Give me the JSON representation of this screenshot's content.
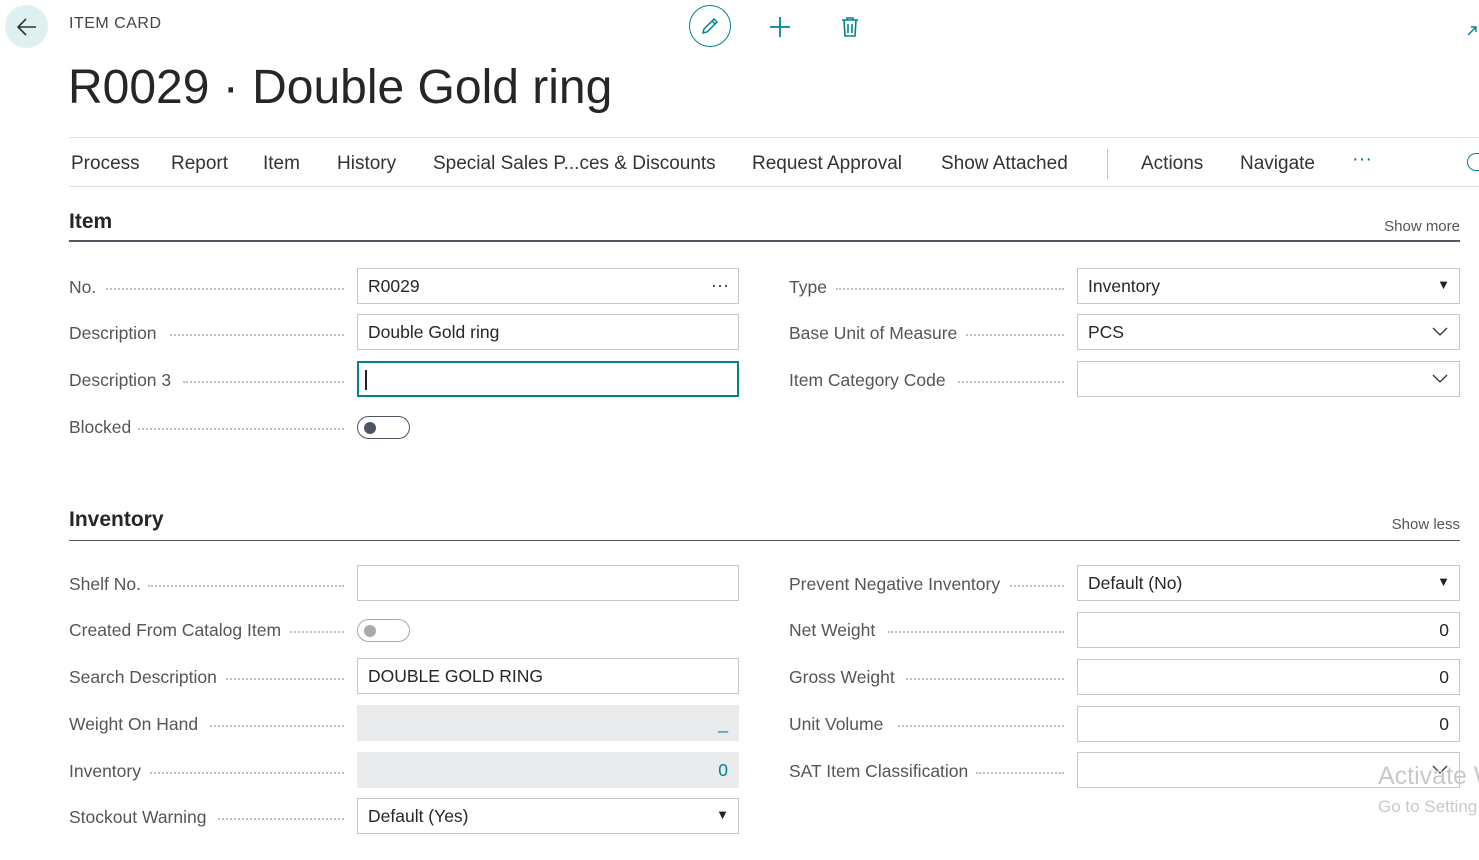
{
  "header": {
    "card_type": "ITEM CARD",
    "title": "R0029 · Double Gold ring"
  },
  "action_bar": {
    "items": [
      "Process",
      "Report",
      "Item",
      "History",
      "Special Sales P...ces & Discounts",
      "Request Approval",
      "Show Attached",
      "Actions",
      "Navigate"
    ],
    "more": "···"
  },
  "sections": {
    "item": {
      "title": "Item",
      "toggle": "Show more",
      "no_label": "No.",
      "no_value": "R0029",
      "description_label": "Description",
      "description_value": "Double Gold ring",
      "description3_label": "Description 3",
      "description3_value": "",
      "blocked_label": "Blocked",
      "blocked_value": false,
      "type_label": "Type",
      "type_value": "Inventory",
      "base_uom_label": "Base Unit of Measure",
      "base_uom_value": "PCS",
      "item_category_label": "Item Category Code",
      "item_category_value": ""
    },
    "inventory": {
      "title": "Inventory",
      "toggle": "Show less",
      "shelf_no_label": "Shelf No.",
      "shelf_no_value": "",
      "created_from_catalog_label": "Created From Catalog Item",
      "created_from_catalog_value": false,
      "search_description_label": "Search Description",
      "search_description_value": "DOUBLE GOLD RING",
      "weight_on_hand_label": "Weight On Hand",
      "weight_on_hand_value": "_",
      "inventory_label": "Inventory",
      "inventory_value": "0",
      "stockout_warning_label": "Stockout Warning",
      "stockout_warning_value": "Default (Yes)",
      "prevent_negative_label": "Prevent Negative Inventory",
      "prevent_negative_value": "Default (No)",
      "net_weight_label": "Net Weight",
      "net_weight_value": "0",
      "gross_weight_label": "Gross Weight",
      "gross_weight_value": "0",
      "unit_volume_label": "Unit Volume",
      "unit_volume_value": "0",
      "sat_classification_label": "SAT Item Classification",
      "sat_classification_value": ""
    }
  },
  "watermark": {
    "line1": "Activate W",
    "line2": "Go to Setting"
  },
  "colors": {
    "accent": "#00838f",
    "section_rule": "#505a64",
    "readonly_bg": "#e9ebed"
  }
}
